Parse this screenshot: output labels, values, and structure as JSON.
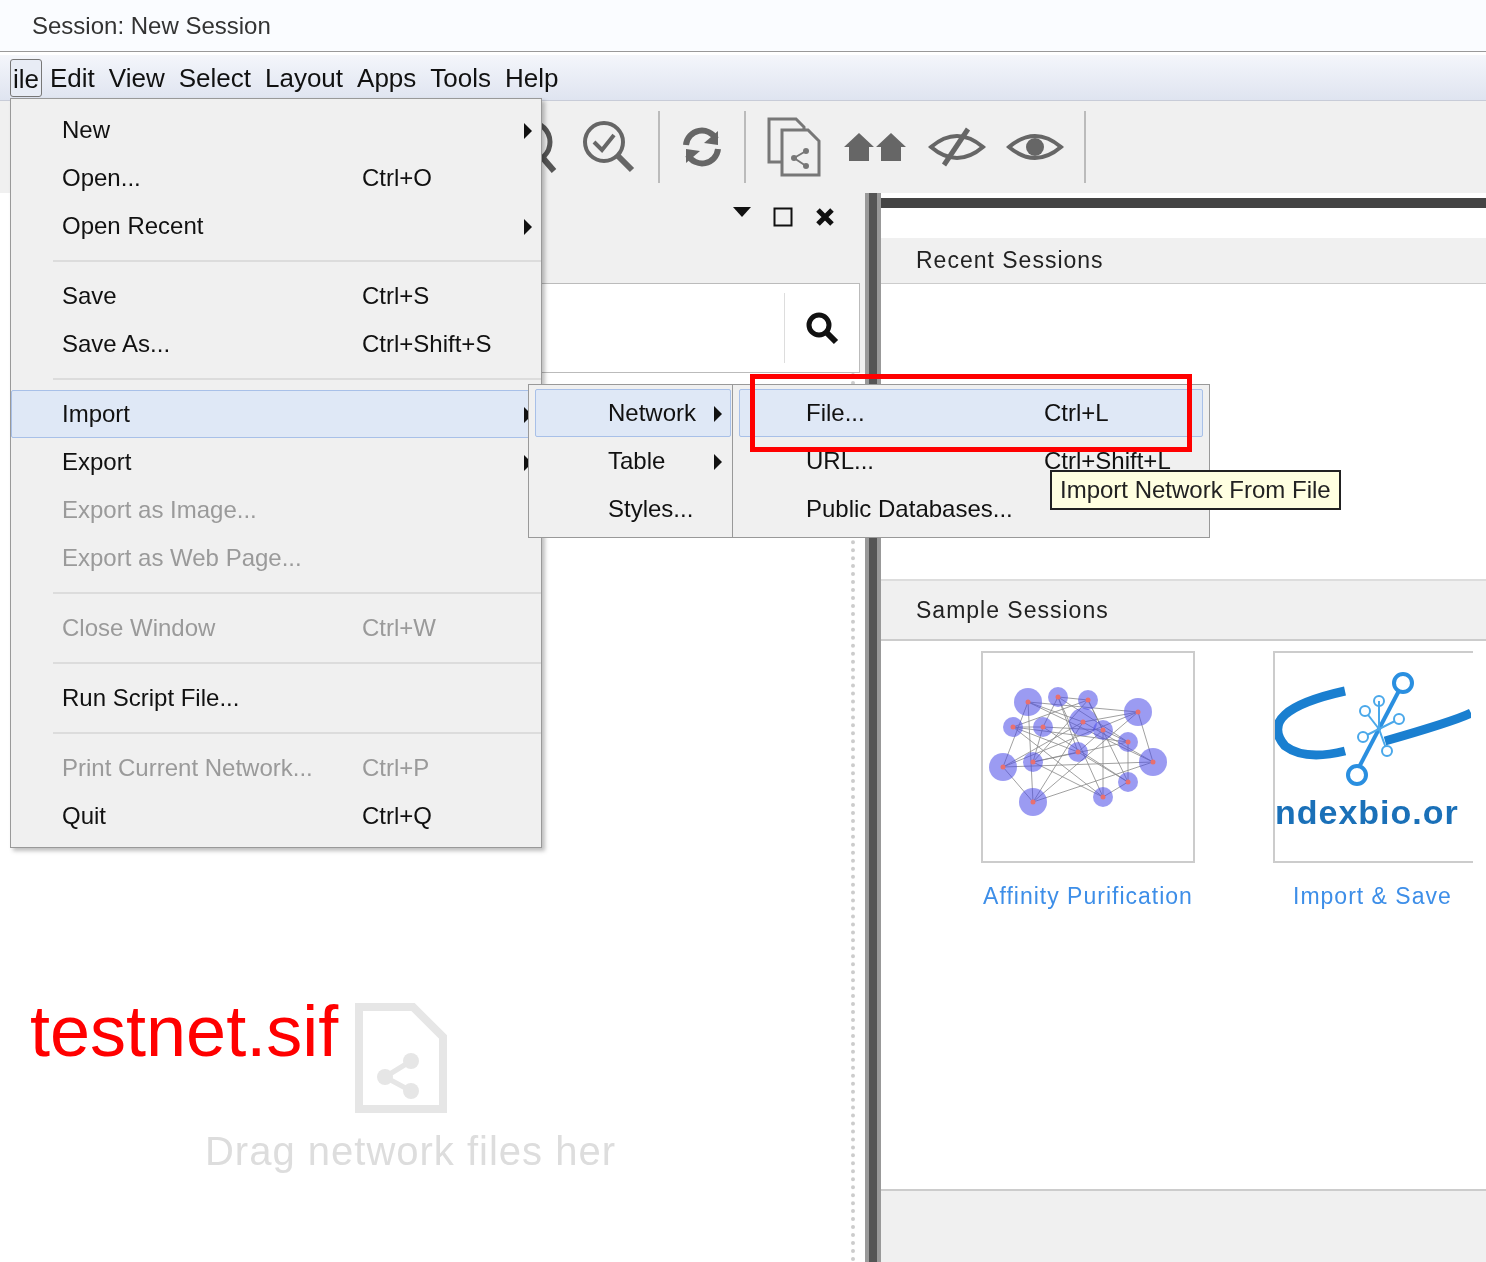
{
  "window": {
    "title": "Session: New Session"
  },
  "menubar": [
    {
      "label": "ile",
      "selected": true
    },
    {
      "label": "Edit",
      "selected": false
    },
    {
      "label": "View",
      "selected": false
    },
    {
      "label": "Select",
      "selected": false
    },
    {
      "label": "Layout",
      "selected": false
    },
    {
      "label": "Apps",
      "selected": false
    },
    {
      "label": "Tools",
      "selected": false
    },
    {
      "label": "Help",
      "selected": false
    }
  ],
  "file_menu": [
    {
      "kind": "item",
      "label": "New",
      "submenu": true,
      "disabled": false,
      "selected": false
    },
    {
      "kind": "item",
      "label": "Open...",
      "shortcut": "Ctrl+O",
      "submenu": false,
      "disabled": false,
      "selected": false
    },
    {
      "kind": "item",
      "label": "Open Recent",
      "submenu": true,
      "disabled": false,
      "selected": false
    },
    {
      "kind": "separator"
    },
    {
      "kind": "item",
      "label": "Save",
      "shortcut": "Ctrl+S",
      "submenu": false,
      "disabled": false,
      "selected": false
    },
    {
      "kind": "item",
      "label": "Save As...",
      "shortcut": "Ctrl+Shift+S",
      "submenu": false,
      "disabled": false,
      "selected": false
    },
    {
      "kind": "separator"
    },
    {
      "kind": "item",
      "label": "Import",
      "submenu": true,
      "disabled": false,
      "selected": true
    },
    {
      "kind": "item",
      "label": "Export",
      "submenu": true,
      "disabled": false,
      "selected": false
    },
    {
      "kind": "item",
      "label": "Export as Image...",
      "submenu": false,
      "disabled": true,
      "selected": false
    },
    {
      "kind": "item",
      "label": "Export as Web Page...",
      "submenu": false,
      "disabled": true,
      "selected": false
    },
    {
      "kind": "separator"
    },
    {
      "kind": "item",
      "label": "Close Window",
      "shortcut": "Ctrl+W",
      "submenu": false,
      "disabled": true,
      "selected": false
    },
    {
      "kind": "separator"
    },
    {
      "kind": "item",
      "label": "Run Script File...",
      "submenu": false,
      "disabled": false,
      "selected": false
    },
    {
      "kind": "separator"
    },
    {
      "kind": "item",
      "label": "Print Current Network...",
      "shortcut": "Ctrl+P",
      "submenu": false,
      "disabled": true,
      "selected": false
    },
    {
      "kind": "item",
      "label": "Quit",
      "shortcut": "Ctrl+Q",
      "submenu": false,
      "disabled": false,
      "selected": false
    }
  ],
  "import_menu": [
    {
      "label": "Network",
      "submenu": true,
      "selected": true
    },
    {
      "label": "Table",
      "submenu": true,
      "selected": false
    },
    {
      "label": "Styles...",
      "submenu": false,
      "selected": false
    }
  ],
  "network_menu": [
    {
      "label": "File...",
      "shortcut": "Ctrl+L",
      "selected": true
    },
    {
      "label": "URL...",
      "shortcut": "Ctrl+Shift+L",
      "selected": false
    },
    {
      "label": "Public Databases...",
      "selected": false
    }
  ],
  "tooltip": "Import Network From File",
  "annotation": "testnet.sif",
  "left_panel": {
    "drop_hint": "Drag network files her"
  },
  "right_panel": {
    "recent_title": "Recent Sessions",
    "sample_title": "Sample Sessions",
    "samples": [
      {
        "kind": "network",
        "label": "Affinity Purification"
      },
      {
        "kind": "logo",
        "logo_text": "ndexbio.or",
        "label": "Import & Save"
      }
    ]
  }
}
